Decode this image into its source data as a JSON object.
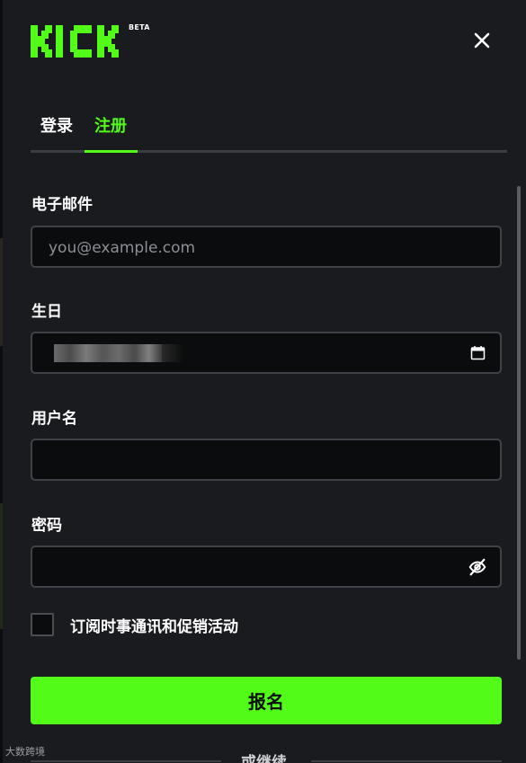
{
  "logo": {
    "text": "KICK",
    "badge": "BETA"
  },
  "tabs": [
    {
      "label": "登录",
      "active": false
    },
    {
      "label": "注册",
      "active": true
    }
  ],
  "form": {
    "email": {
      "label": "电子邮件",
      "placeholder": "you@example.com",
      "value": ""
    },
    "birthday": {
      "label": "生日"
    },
    "username": {
      "label": "用户名",
      "value": ""
    },
    "password": {
      "label": "密码",
      "value": ""
    },
    "newsletter": {
      "label": "订阅时事通讯和促销活动",
      "checked": false
    },
    "submit_label": "报名",
    "or_continue": "或继续"
  },
  "watermark": "大数跨境",
  "colors": {
    "accent": "#53fc18",
    "background": "#191b1f",
    "input_bg": "#0b0c0d",
    "border": "#3f4247"
  },
  "icons": {
    "close": "close-icon",
    "calendar": "calendar-icon",
    "password_toggle": "eye-slash-icon"
  }
}
